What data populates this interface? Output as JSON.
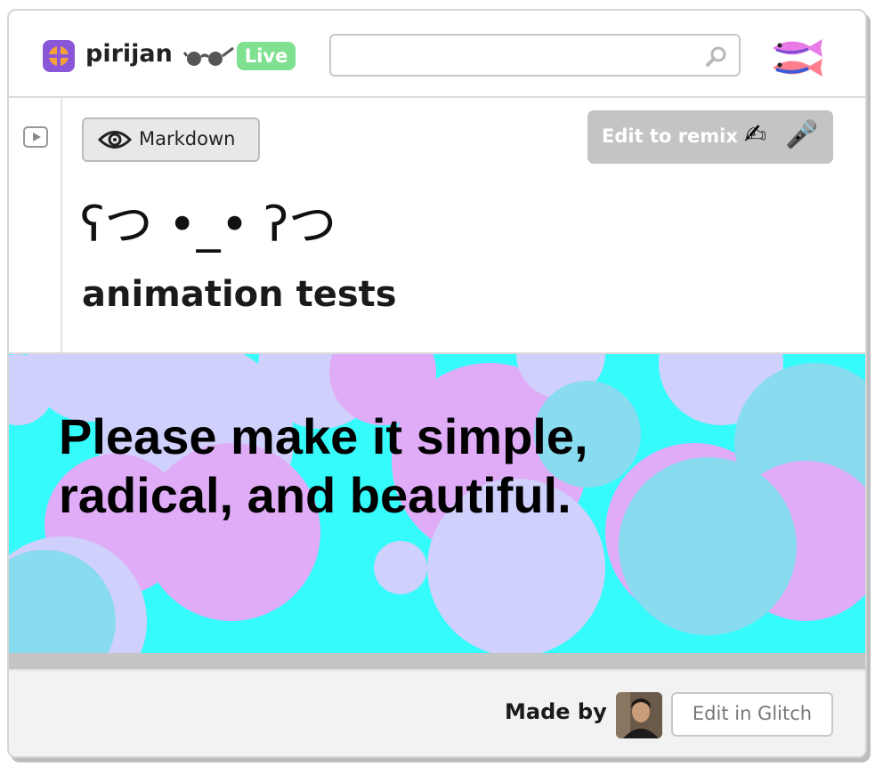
{
  "header": {
    "project_name": "pirijan",
    "live_badge": "Live",
    "search": {
      "value": "",
      "placeholder": ""
    }
  },
  "toolbar": {
    "markdown_label": "Markdown",
    "remix_label": "Edit to remix",
    "remix_emoji_1": "✍",
    "remix_emoji_2": "🎤"
  },
  "document": {
    "kaomoji": "ʕつ •_• ʔつ",
    "title": "animation tests"
  },
  "banner": {
    "quote_line_1": "Please make it simple,",
    "quote_line_2": "radical, and beautiful."
  },
  "footer": {
    "made_by_label": "Made by",
    "edit_in_glitch_label": "Edit in Glitch"
  },
  "colors": {
    "banner_background": "#35fbfb",
    "circle_pink": "#e0acf7",
    "circle_lavender": "#cfd0fb",
    "circle_blue": "#89dbf0",
    "live_badge": "#7fe08f",
    "project_icon": "#8a57d9"
  }
}
